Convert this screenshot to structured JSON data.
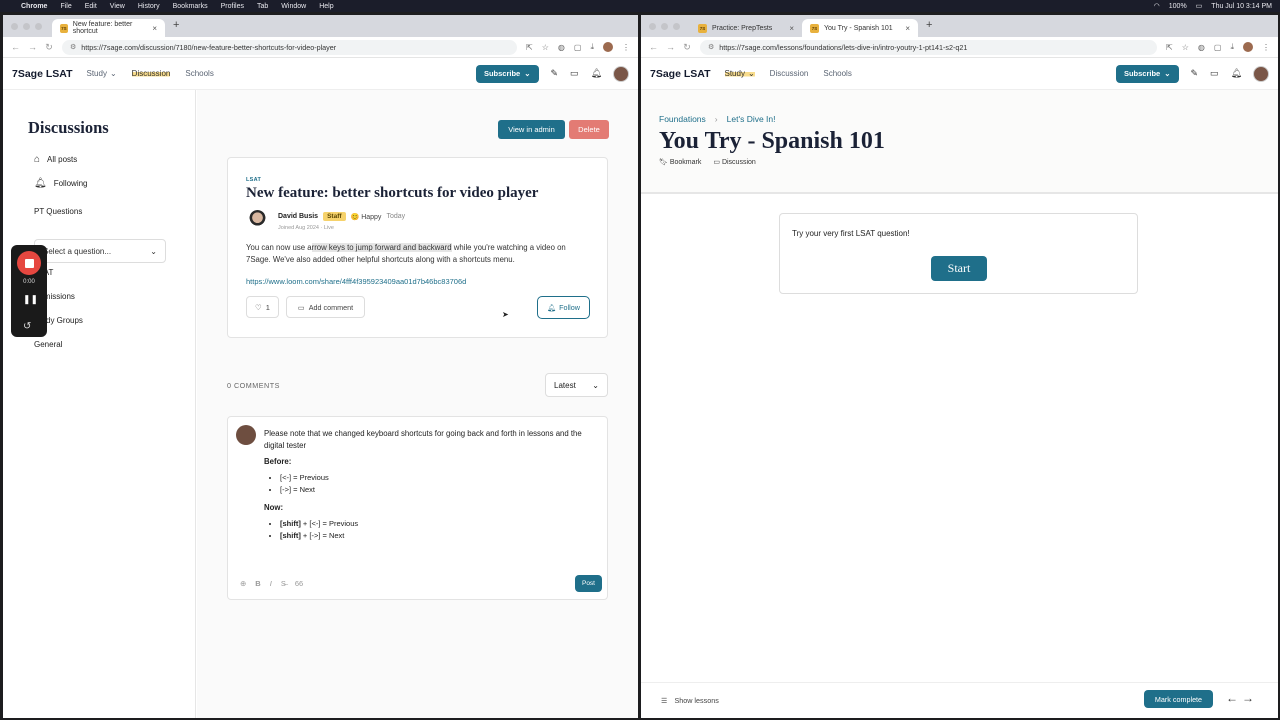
{
  "menubar": {
    "apple": "",
    "items": [
      "Chrome",
      "File",
      "Edit",
      "View",
      "History",
      "Bookmarks",
      "Profiles",
      "Tab",
      "Window",
      "Help"
    ],
    "battery": "100%",
    "datetime": "Thu Jul 10  3:14 PM"
  },
  "left": {
    "tab": {
      "label": "New feature: better shortcut",
      "close": "×"
    },
    "newtab": "+",
    "url": "https://7sage.com/discussion/7180/new-feature-better-shortcuts-for-video-player",
    "site": {
      "logo": "7Sage LSAT",
      "study": "Study",
      "discussion": "Discussion",
      "schools": "Schools",
      "subscribe": "Subscribe"
    },
    "sidebar": {
      "title": "Discussions",
      "all_posts": "All posts",
      "following": "Following",
      "pt_questions": "PT Questions",
      "select_placeholder": "Select a question...",
      "lsat": "LSAT",
      "admissions": "Admissions",
      "study_groups": "Study Groups",
      "general": "General"
    },
    "actions": {
      "view_admin": "View in admin",
      "delete": "Delete"
    },
    "post": {
      "tag": "LSAT",
      "title": "New feature: better shortcuts for video player",
      "author": "David Busis",
      "badge": "Staff",
      "mood": "😊 Happy",
      "time": "Today",
      "joined": "Joined Aug 2024 · Live",
      "body_pre": "You can now use a",
      "body_highlight": "rrow keys to jump forward and backward",
      "body_post": " while you're watching a video on 7Sage. We've also added other helpful shortcuts along with a shortcuts menu.",
      "link": "https://www.loom.com/share/4fff4f395923409aa01d7b46bc83706d",
      "likes": "1",
      "add_comment": "Add comment",
      "follow": "Follow"
    },
    "comments_count": "0 COMMENTS",
    "sort": "Latest",
    "comment": {
      "intro": "Please note that we changed keyboard shortcuts for going back and forth in lessons and the digital tester",
      "before_label": "Before:",
      "before_items": [
        "[<-] = Previous",
        "[->] = Next"
      ],
      "now_label": "Now:",
      "now_items_key": "[shift]",
      "now_items": [
        " + [<-] = Previous",
        " + [->] = Next"
      ],
      "post_button": "Post"
    },
    "recorder": {
      "time": "0:00"
    }
  },
  "right": {
    "tabs": [
      {
        "label": "Practice: PrepTests",
        "close": "×"
      },
      {
        "label": "You Try - Spanish 101",
        "close": "×"
      }
    ],
    "newtab": "+",
    "url": "https://7sage.com/lessons/foundations/lets-dive-in/intro-youtry-1-pt141-s2-q21",
    "site": {
      "logo": "7Sage LSAT",
      "study": "Study",
      "discussion": "Discussion",
      "schools": "Schools",
      "subscribe": "Subscribe"
    },
    "crumbs": [
      "Foundations",
      "Let's Dive In!"
    ],
    "title": "You Try - Spanish 101",
    "bookmark": "Bookmark",
    "discussion": "Discussion",
    "prompt": "Try your very first LSAT question!",
    "start": "Start",
    "show_lessons": "Show lessons",
    "mark_complete": "Mark complete"
  },
  "favicon": "7S",
  "colors": {
    "brand": "#1f6f8a",
    "danger": "#e37b74",
    "highlight": "#f8dc8c",
    "record": "#e64740"
  }
}
